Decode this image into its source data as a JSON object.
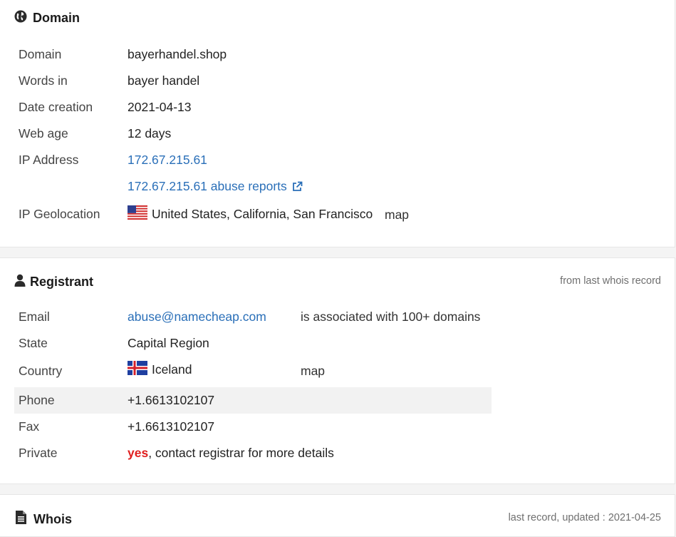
{
  "domain_panel": {
    "title": "Domain",
    "icon": "globe-icon",
    "rows": {
      "domain": {
        "label": "Domain",
        "value": "bayerhandel.shop"
      },
      "words_in": {
        "label": "Words in",
        "value": "bayer handel"
      },
      "date_creation": {
        "label": "Date creation",
        "value": "2021-04-13"
      },
      "web_age": {
        "label": "Web age",
        "value": "12 days"
      },
      "ip_address": {
        "label": "IP Address",
        "value": "172.67.215.61"
      },
      "abuse_reports": {
        "value": "172.67.215.61 abuse reports"
      },
      "ip_geolocation": {
        "label": "IP Geolocation",
        "value": "United States, California, San Francisco",
        "map_link": "map",
        "flag": "us-flag-icon"
      }
    }
  },
  "registrant_panel": {
    "title": "Registrant",
    "icon": "user-icon",
    "note": "from last whois record",
    "rows": {
      "email": {
        "label": "Email",
        "value": "abuse@namecheap.com",
        "extra": "is associated with 100+ domains"
      },
      "state": {
        "label": "State",
        "value": "Capital Region"
      },
      "country": {
        "label": "Country",
        "value": "Iceland",
        "map_link": "map",
        "flag": "iceland-flag-icon"
      },
      "phone": {
        "label": "Phone",
        "value": "+1.6613102107"
      },
      "fax": {
        "label": "Fax",
        "value": "+1.6613102107"
      },
      "private": {
        "label": "Private",
        "value_strong": "yes",
        "value_rest": ", contact registrar for more details"
      }
    }
  },
  "whois_panel": {
    "title": "Whois",
    "icon": "document-icon",
    "note": "last record, updated : 2021-04-25"
  },
  "colors": {
    "link": "#2a6fb8",
    "alert": "#e02020",
    "shaded_row": "#f2f2f2"
  }
}
